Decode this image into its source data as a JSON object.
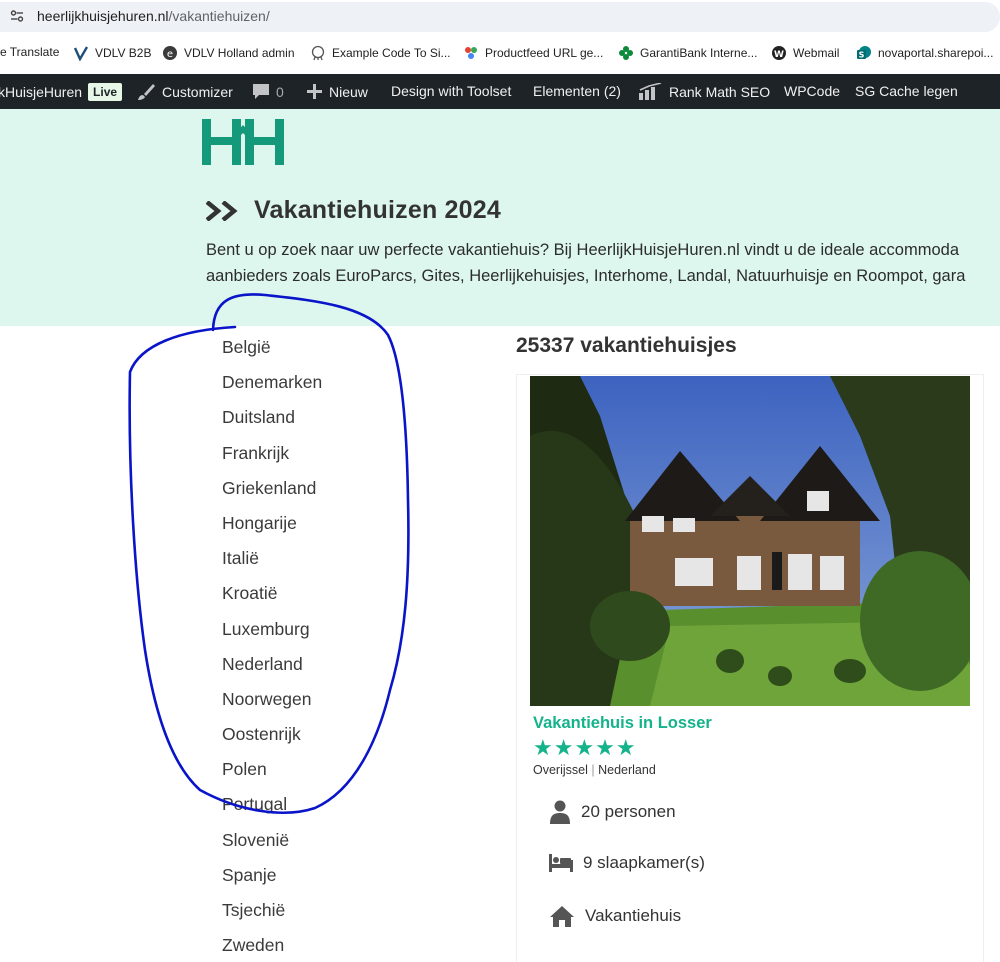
{
  "browser": {
    "url_domain": "heerlijkhuisjehuren.nl",
    "url_path": "/vakantiehuizen/"
  },
  "bookmarks": [
    {
      "label": "e Translate",
      "icon": "translate-icon"
    },
    {
      "label": "VDLV B2B",
      "icon": "vdlv-icon"
    },
    {
      "label": "VDLV Holland admin",
      "icon": "vdlv-e-icon"
    },
    {
      "label": "Example Code To Si...",
      "icon": "octocat-icon"
    },
    {
      "label": "Productfeed URL ge...",
      "icon": "feed-icon"
    },
    {
      "label": "GarantiBank Interne...",
      "icon": "clover-icon"
    },
    {
      "label": "Webmail",
      "icon": "wordpress-icon"
    },
    {
      "label": "novaportal.sharepoi...",
      "icon": "sharepoint-icon"
    }
  ],
  "adminbar": {
    "site_name": "kHuisjeHuren",
    "live_label": "Live",
    "customizer": "Customizer",
    "comments_count": "0",
    "new_label": "Nieuw",
    "toolset": "Design with Toolset",
    "elements": "Elementen (2)",
    "rankmath": "Rank Math SEO",
    "wpcode": "WPCode",
    "cache": "SG Cache legen"
  },
  "hero": {
    "title": "Vakantiehuizen 2024",
    "intro_line1": "Bent u op zoek naar uw perfecte vakantiehuis? Bij HeerlijkHuisjeHuren.nl vindt u de ideale accommoda",
    "intro_line2": "aanbieders zoals EuroParcs, Gites, Heerlijkehuisjes, Interhome, Landal, Natuurhuisje en Roompot, gara"
  },
  "countries": [
    "België",
    "Denemarken",
    "Duitsland",
    "Frankrijk",
    "Griekenland",
    "Hongarije",
    "Italië",
    "Kroatië",
    "Luxemburg",
    "Nederland",
    "Noorwegen",
    "Oostenrijk",
    "Polen",
    "Portugal",
    "Slovenië",
    "Spanje",
    "Tsjechië",
    "Zweden"
  ],
  "results": {
    "count_label": "25337 vakantiehuisjes"
  },
  "card": {
    "title": "Vakantiehuis in Losser",
    "stars": "★★★★★",
    "rating": 5,
    "province": "Overijssel",
    "country": "Nederland",
    "persons": "20 personen",
    "bedrooms": "9 slaapkamer(s)",
    "type": "Vakantiehuis"
  },
  "colors": {
    "accent": "#15b38b",
    "hero_bg": "#ddf7ef",
    "admin_bg": "#1d2327",
    "annotation": "#0a14c8"
  }
}
